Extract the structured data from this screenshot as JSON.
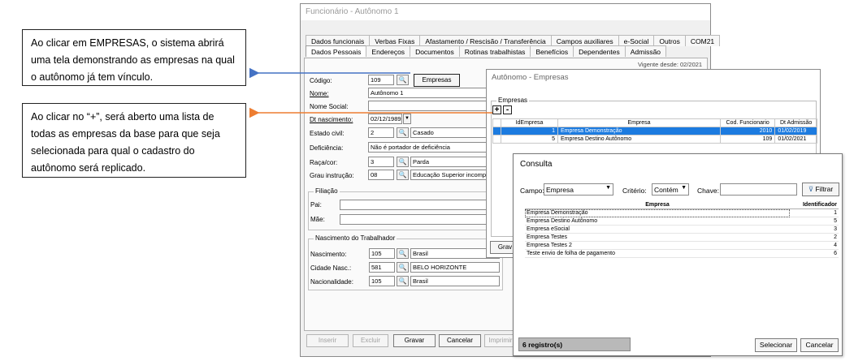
{
  "callouts": {
    "empresas": "Ao clicar em EMPRESAS, o sistema abrirá uma tela demonstrando as empresas na qual o autônomo já tem vínculo.",
    "plus": "Ao clicar no “+”, será aberto uma lista de todas as empresas da base para que seja selecionada para qual o cadastro do autônomo será replicado."
  },
  "colors": {
    "arrow_blue": "#4472c4",
    "arrow_orange": "#ed7d31",
    "selection": "#1c7be0"
  },
  "main_window": {
    "title": "Funcionário - Autônomo 1",
    "tabs_row1": [
      "Dados funcionais",
      "Verbas Fixas",
      "Afastamento / Rescisão / Transferência",
      "Campos auxiliares",
      "e-Social",
      "Outros",
      "COM21"
    ],
    "tabs_row2": [
      "Dados Pessoais",
      "Endereços",
      "Documentos",
      "Rotinas trabalhistas",
      "Benefícios",
      "Dependentes",
      "Admissão"
    ],
    "vigente": "Vigente desde: 02/2021",
    "fields": {
      "codigo_label": "Código:",
      "codigo_value": "109",
      "empresas_button": "Empresas",
      "nome_label": "Nome:",
      "nome_value": "Autônomo 1",
      "nome_social_label": "Nome Social:",
      "dt_nasc_label": "Dt nascimento:",
      "dt_nasc_value": "02/12/1989",
      "estado_civil_label": "Estado civil:",
      "estado_civil_code": "2",
      "estado_civil_value": "Casado",
      "deficiencia_label": "Deficiência:",
      "deficiencia_value": "Não é portador de deficiência",
      "raca_label": "Raça/cor:",
      "raca_code": "3",
      "raca_value": "Parda",
      "grau_label": "Grau instrução:",
      "grau_code": "08",
      "grau_value": "Educação Superior incompl"
    },
    "filiacao": {
      "title": "Filiação",
      "pai_label": "Pai:",
      "mae_label": "Mãe:"
    },
    "nascimento": {
      "title": "Nascimento do Trabalhador",
      "nasc_label": "Nascimento:",
      "nasc_code": "105",
      "nasc_value": "Brasil",
      "cidade_label": "Cidade Nasc.:",
      "cidade_code": "581",
      "cidade_value": "BELO HORIZONTE",
      "nac_label": "Nacionalidade:",
      "nac_code": "105",
      "nac_value": "Brasil"
    },
    "buttons": {
      "inserir": "Inserir",
      "excluir": "Excluir",
      "gravar": "Gravar",
      "cancelar": "Cancelar",
      "imprimir": "Imprimir"
    }
  },
  "empresas_window": {
    "title": "Autônomo - Empresas",
    "group": "Empresas",
    "plus": "+",
    "minus": "-",
    "columns": [
      "IdEmpresa",
      "Empresa",
      "Cod. Funcionario",
      "Dt Admissão"
    ],
    "rows": [
      [
        "1",
        "Empresa Demonstração",
        "2010",
        "01/02/2019"
      ],
      [
        "5",
        "Empresa Destino Autônomo",
        "109",
        "01/02/2021"
      ]
    ],
    "gravar_partial": "Grav"
  },
  "consulta_window": {
    "title": "Consulta",
    "campo_label": "Campo:",
    "campo_value": "Empresa",
    "criterio_label": "Critério:",
    "criterio_value": "Contém",
    "chave_label": "Chave:",
    "chave_value": "",
    "filtrar": "Filtrar",
    "columns": [
      "Empresa",
      "Identificador"
    ],
    "rows": [
      [
        "Empresa Demonstração",
        "1"
      ],
      [
        "Empresa Destino Autônomo",
        "5"
      ],
      [
        "Empresa eSocial",
        "3"
      ],
      [
        "Empresa Testes",
        "2"
      ],
      [
        "Empresa Testes 2",
        "4"
      ],
      [
        "Teste envio de folha de pagamento",
        "6"
      ]
    ],
    "status": "6 registro(s)",
    "selecionar": "Selecionar",
    "cancelar": "Cancelar"
  }
}
